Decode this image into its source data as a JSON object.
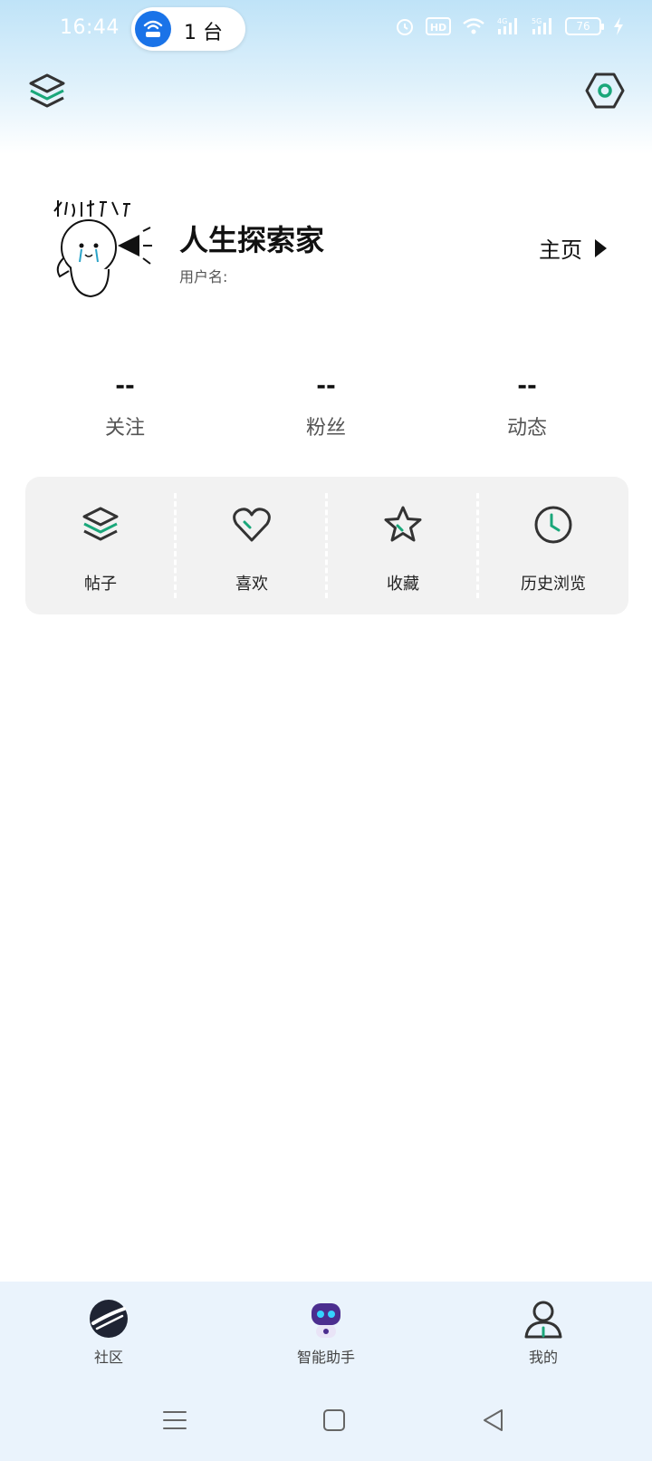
{
  "status_bar": {
    "time": "16:44",
    "hotspot": {
      "icon": "hotspot-router-icon",
      "label": "1 台"
    },
    "icons": [
      "alarm-icon",
      "hd-icon",
      "wifi-icon",
      "signal-4g-icon",
      "signal-5g-icon"
    ],
    "battery": "76",
    "charging_icon": "bolt-icon"
  },
  "header": {
    "left_icon": "layers-icon",
    "right_icon": "settings-hexagon-icon"
  },
  "profile": {
    "avatar_icon": "avatar-sticker-icon",
    "nickname": "人生探索家",
    "username_label": "用户名:",
    "homepage_label": "主页"
  },
  "stats": [
    {
      "value": "--",
      "label": "关注"
    },
    {
      "value": "--",
      "label": "粉丝"
    },
    {
      "value": "--",
      "label": "动态"
    }
  ],
  "menu": [
    {
      "label": "帖子",
      "icon": "layers-icon"
    },
    {
      "label": "喜欢",
      "icon": "heart-icon"
    },
    {
      "label": "收藏",
      "icon": "star-icon"
    },
    {
      "label": "历史浏览",
      "icon": "clock-icon"
    }
  ],
  "bottom_nav": [
    {
      "label": "社区",
      "icon": "planet-icon"
    },
    {
      "label": "智能助手",
      "icon": "robot-icon"
    },
    {
      "label": "我的",
      "icon": "user-icon"
    }
  ],
  "system_nav": [
    "menu-icon",
    "home-icon",
    "back-icon"
  ],
  "colors": {
    "accent": "#1aa77a",
    "icon_dark": "#3a3a3a",
    "hotspot_blue": "#1a73e8",
    "nav_bg": "#eaf3fc"
  }
}
